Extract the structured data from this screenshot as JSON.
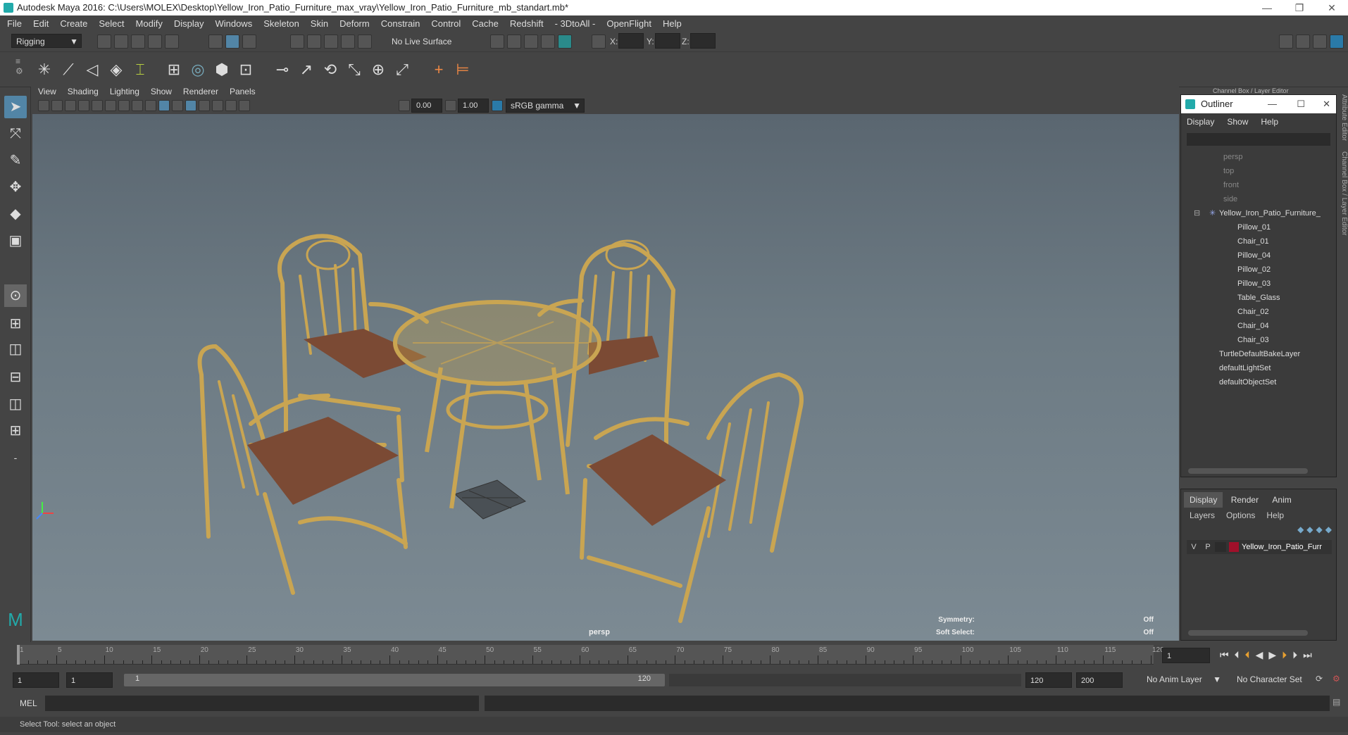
{
  "title": "Autodesk Maya 2016: C:\\Users\\MOLEX\\Desktop\\Yellow_Iron_Patio_Furniture_max_vray\\Yellow_Iron_Patio_Furniture_mb_standart.mb*",
  "menu": [
    "File",
    "Edit",
    "Create",
    "Select",
    "Modify",
    "Display",
    "Windows",
    "Skeleton",
    "Skin",
    "Deform",
    "Constrain",
    "Control",
    "Cache",
    "Redshift",
    "- 3DtoAll -",
    "OpenFlight",
    "Help"
  ],
  "status": {
    "mode": "Rigging",
    "live_surface": "No Live Surface",
    "x_label": "X:",
    "y_label": "Y:",
    "z_label": "Z:"
  },
  "panel_menu": [
    "View",
    "Shading",
    "Lighting",
    "Show",
    "Renderer",
    "Panels"
  ],
  "panel_toolbar": {
    "near": "0.00",
    "far": "1.00",
    "color_space": "sRGB gamma"
  },
  "viewport": {
    "camera": "persp",
    "symmetry_label": "Symmetry:",
    "symmetry_value": "Off",
    "soft_select_label": "Soft Select:",
    "soft_select_value": "Off"
  },
  "channel_box_title": "Channel Box / Layer Editor",
  "side_tabs": [
    "Attribute Editor",
    "Channel Box / Layer Editor"
  ],
  "outliner": {
    "title": "Outliner",
    "menu": [
      "Display",
      "Show",
      "Help"
    ],
    "cameras": [
      "persp",
      "top",
      "front",
      "side"
    ],
    "group": "Yellow_Iron_Patio_Furniture_",
    "children": [
      "Pillow_01",
      "Chair_01",
      "Pillow_04",
      "Pillow_02",
      "Pillow_03",
      "Table_Glass",
      "Chair_02",
      "Chair_04",
      "Chair_03"
    ],
    "sets": [
      "TurtleDefaultBakeLayer",
      "defaultLightSet",
      "defaultObjectSet"
    ]
  },
  "layers": {
    "tabs": [
      "Display",
      "Render",
      "Anim"
    ],
    "menu": [
      "Layers",
      "Options",
      "Help"
    ],
    "row": {
      "v": "V",
      "p": "P",
      "name": "Yellow_Iron_Patio_Furr",
      "color": "#a0102a"
    }
  },
  "timeline": {
    "ticks": [
      "1",
      "5",
      "10",
      "15",
      "20",
      "25",
      "30",
      "35",
      "40",
      "45",
      "50",
      "55",
      "60",
      "65",
      "70",
      "75",
      "80",
      "85",
      "90",
      "95",
      "100",
      "105",
      "110",
      "115",
      "120"
    ],
    "current_frame": "1"
  },
  "range": {
    "start": "1",
    "inner_start": "1",
    "slider_start": "1",
    "slider_end": "120",
    "end": "120",
    "max": "200",
    "anim_layer": "No Anim Layer",
    "char_set": "No Character Set"
  },
  "cmd": {
    "lang": "MEL"
  },
  "help_line": "Select Tool: select an object"
}
